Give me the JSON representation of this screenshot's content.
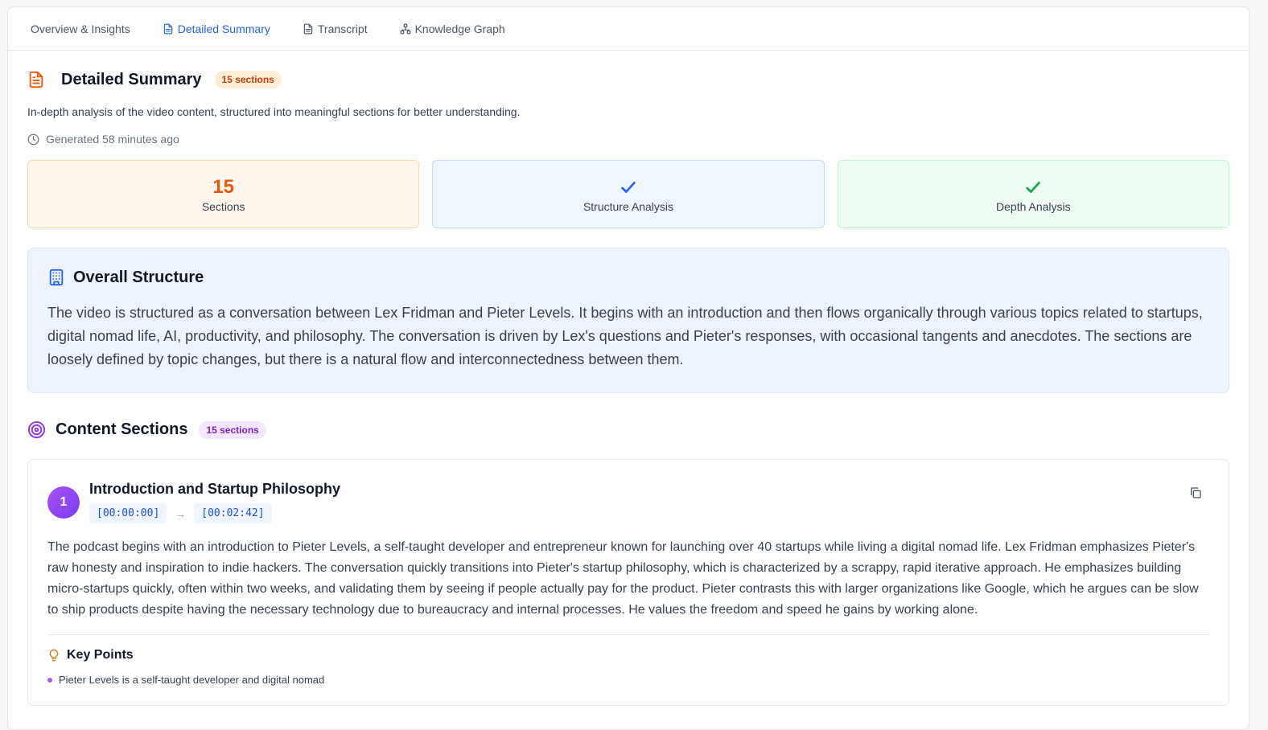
{
  "tabs": [
    {
      "label": "Overview & Insights",
      "icon": "none"
    },
    {
      "label": "Detailed Summary",
      "icon": "document-icon"
    },
    {
      "label": "Transcript",
      "icon": "document-icon"
    },
    {
      "label": "Knowledge Graph",
      "icon": "network-icon"
    }
  ],
  "header": {
    "title": "Detailed Summary",
    "badge": "15 sections",
    "description": "In-depth analysis of the video content, structured into meaningful sections for better understanding.",
    "generated": "Generated 58 minutes ago"
  },
  "stats": [
    {
      "value": "15",
      "label": "Sections"
    },
    {
      "value": "✓",
      "label": "Structure Analysis"
    },
    {
      "value": "✓",
      "label": "Depth Analysis"
    }
  ],
  "overall": {
    "title": "Overall Structure",
    "text": "The video is structured as a conversation between Lex Fridman and Pieter Levels. It begins with an introduction and then flows organically through various topics related to startups, digital nomad life, AI, productivity, and philosophy. The conversation is driven by Lex's questions and Pieter's responses, with occasional tangents and anecdotes. The sections are loosely defined by topic changes, but there is a natural flow and interconnectedness between them."
  },
  "content_sections": {
    "title": "Content Sections",
    "badge": "15 sections",
    "items": [
      {
        "number": "1",
        "title": "Introduction and Startup Philosophy",
        "start": "[00:00:00]",
        "arrow": "→",
        "end": "[00:02:42]",
        "body": "The podcast begins with an introduction to Pieter Levels, a self-taught developer and entrepreneur known for launching over 40 startups while living a digital nomad life. Lex Fridman emphasizes Pieter's raw honesty and inspiration to indie hackers. The conversation quickly transitions into Pieter's startup philosophy, which is characterized by a scrappy, rapid iterative approach. He emphasizes building micro-startups quickly, often within two weeks, and validating them by seeing if people actually pay for the product. Pieter contrasts this with larger organizations like Google, which he argues can be slow to ship products despite having the necessary technology due to bureaucracy and internal processes. He values the freedom and speed he gains by working alone.",
        "key_points_title": "Key Points",
        "key_points": [
          "Pieter Levels is a self-taught developer and digital nomad"
        ]
      }
    ]
  },
  "colors": {
    "accent_blue": "#2563eb",
    "accent_orange": "#ea580c",
    "accent_purple": "#a855f7",
    "accent_green": "#16a34a"
  }
}
